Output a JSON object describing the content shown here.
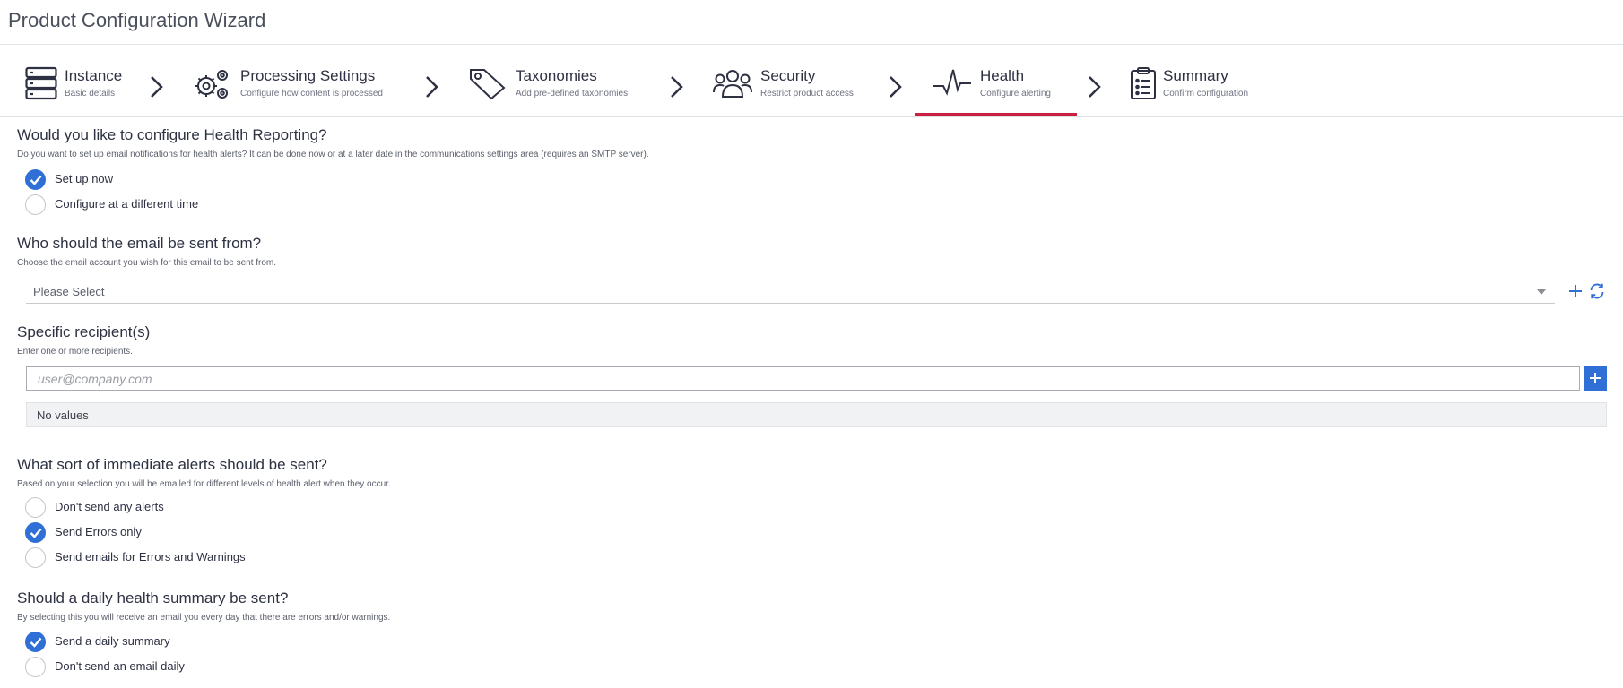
{
  "window": {
    "title": "Product Configuration Wizard"
  },
  "steps": [
    {
      "label": "Instance",
      "sub": "Basic details",
      "icon": "server-icon"
    },
    {
      "label": "Processing Settings",
      "sub": "Configure how content is processed",
      "icon": "gears-icon"
    },
    {
      "label": "Taxonomies",
      "sub": "Add pre-defined taxonomies",
      "icon": "tag-icon"
    },
    {
      "label": "Security",
      "sub": "Restrict product access",
      "icon": "users-icon"
    },
    {
      "label": "Health",
      "sub": "Configure alerting",
      "icon": "heartbeat-icon",
      "active": true
    },
    {
      "label": "Summary",
      "sub": "Confirm configuration",
      "icon": "clipboard-list-icon"
    }
  ],
  "health_reporting": {
    "title": "Would you like to configure Health Reporting?",
    "desc": "Do you want to set up email notifications for health alerts? It can be done now or at a later date in the communications settings area (requires an SMTP server).",
    "options": [
      {
        "label": "Set up now",
        "checked": true
      },
      {
        "label": "Configure at a different time",
        "checked": false
      }
    ]
  },
  "sender": {
    "title": "Who should the email be sent from?",
    "desc": "Choose the email account you wish for this email to be sent from.",
    "placeholder": "Please Select"
  },
  "recipients": {
    "title": "Specific recipient(s)",
    "desc": "Enter one or more recipients.",
    "placeholder": "user@company.com",
    "value": "",
    "empty_text": "No values"
  },
  "immediate_alerts": {
    "title": "What sort of immediate alerts should be sent?",
    "desc": "Based on your selection you will be emailed for different levels of health alert when they occur.",
    "options": [
      {
        "label": "Don't send any alerts",
        "checked": false
      },
      {
        "label": "Send Errors only",
        "checked": true
      },
      {
        "label": "Send emails for Errors and Warnings",
        "checked": false
      }
    ]
  },
  "daily_summary": {
    "title": "Should a daily health summary be sent?",
    "desc": "By selecting this you will receive an email you every day that there are errors and/or warnings.",
    "options": [
      {
        "label": "Send a daily summary",
        "checked": true
      },
      {
        "label": "Don't send an email daily",
        "checked": false
      }
    ]
  },
  "colors": {
    "accent": "#2f6fd6",
    "active_tab": "#c8203f",
    "text": "#2d3142"
  }
}
